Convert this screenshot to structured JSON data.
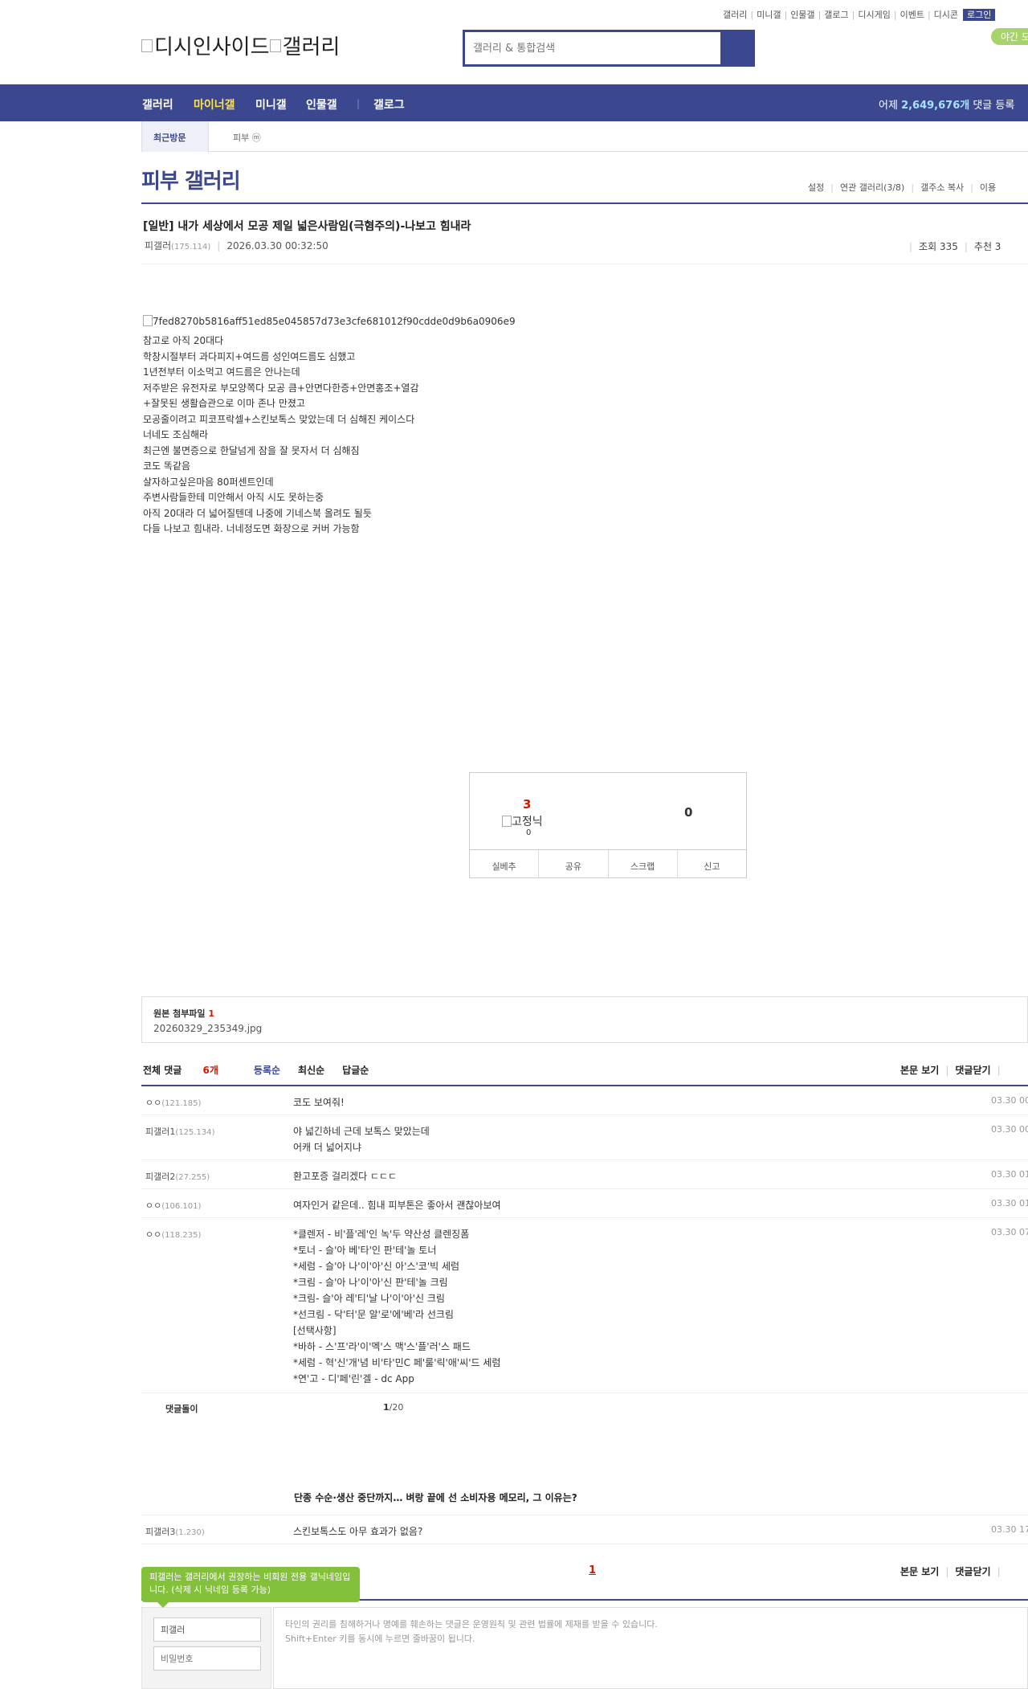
{
  "top_util": {
    "links": [
      "갤러리",
      "미니갤",
      "인물갤",
      "갤로그",
      "디시게임",
      "이벤트",
      "디시콘"
    ],
    "login": "로그인",
    "night_mode": "야간 모"
  },
  "logo": {
    "site": "디시인사이드",
    "section": "갤러리"
  },
  "search": {
    "placeholder": "갤러리 & 통합검색"
  },
  "nav": {
    "items": [
      "갤러리",
      "마이너갤",
      "미니갤",
      "인물갤",
      "갤로그"
    ],
    "comment_count_prefix": "어제 ",
    "comment_count_value": "2,649,676개",
    "comment_count_suffix": " 댓글 등록"
  },
  "recent": {
    "tab": "최근방문",
    "item": "피부 ⓜ"
  },
  "gallery": {
    "title": "피부 갤러리",
    "menu": [
      "설정",
      "연관 갤러리(3/8)",
      "갤주소 복사",
      "이용"
    ]
  },
  "post": {
    "title": "[일반] 내가 세상에서 모공 제일 넓은사람임(극혐주의)-나보고 힘내라",
    "writer": "피갤러",
    "writer_ip": "(175.114)",
    "date": "2026.03.30 00:32:50",
    "views": "조회 335",
    "recommends": "추천 3",
    "image_alt": "7fed8270b5816aff51ed85e045857d73e3cfe681012f90cdde0d9b6a0906e9",
    "body": [
      "참고로 아직 20대다",
      "학창시절부터 과다피지+여드름 성인여드름도 심했고",
      "1년전부터 이소먹고 여드름은 안나는데",
      "저주받은 유전자로 부모양쪽다 모공 큼+안면다한증+안면홍조+열감",
      "+잘못된 생활습관으로 이마 존나 만졌고",
      "모공줄이려고 피코프락셀+스킨보톡스 맞았는데 더 심해진 케이스다",
      "너네도 조심해라",
      "최근엔 불면증으로 한달넘게 잠을 잘 못자서 더 심해짐",
      "코도 똑같음",
      "살자하고싶은마음 80퍼센트인데",
      "주변사람들한테 미안해서 아직 시도 못하는중",
      "아직 20대라 더 넓어질텐데 나중에 기네스북 올려도 될듯",
      "다들 나보고 힘내라. 너네정도면 화장으로 커버 가능함"
    ]
  },
  "vote": {
    "up": "3",
    "fixnick_alt": "고정닉",
    "fixnick_count": "0",
    "down": "0",
    "actions": [
      "실베추",
      "공유",
      "스크랩",
      "신고"
    ]
  },
  "attachment": {
    "label": "원본 첨부파일",
    "count": "1",
    "file": "20260329_235349.jpg"
  },
  "comments_header": {
    "total_label": "전체 댓글",
    "total_count": "6개",
    "sorts": [
      "등록순",
      "최신순",
      "답글순"
    ],
    "view_body": "본문 보기",
    "close_comments": "댓글닫기"
  },
  "comments": [
    {
      "nick": "ㅇㅇ",
      "ip": "(121.185)",
      "text": [
        "코도 보여줘!"
      ],
      "date": "03.30 00"
    },
    {
      "nick": "피갤러1",
      "ip": "(125.134)",
      "text": [
        "야 넓긴하네 근데 보톡스 맞았는데",
        "어캐 더 넓어지냐"
      ],
      "date": "03.30 00"
    },
    {
      "nick": "피갤러2",
      "ip": "(27.255)",
      "text": [
        "환고포증 걸리겠다 ㄷㄷㄷ"
      ],
      "date": "03.30 01"
    },
    {
      "nick": "ㅇㅇ",
      "ip": "(106.101)",
      "text": [
        "여자인거 같은데.. 힘내 피부톤은 좋아서 괜찮아보여"
      ],
      "date": "03.30 01"
    },
    {
      "nick": "ㅇㅇ",
      "ip": "(118.235)",
      "text": [
        "*클렌저 - 비'플'레'인 녹'두 약산성 클렌징폼",
        "*토너 - 슬'아 베'타'인 판'테'놀 토너",
        "*세럼 - 슬'아 나'이'아'신 아'스'코'빅 세럼",
        "*크림 - 슬'아 나'이'아'신 판'테'놀 크림",
        "*크림- 슬'아 레'티'날 나'이'아'신 크림",
        "*선크림 - 닥'터'문 알'로'에'베'라 선크림",
        "[선택사항]",
        "*바하 - 스'프'라'이'멕'스 맥'스'플'러'스 패드",
        "*세럼 - 혁'신'개'념 비'타'민C 페'룰'릭'애'씨'드 세럼",
        "*연'고 - 디'페'린'겔 - dc App"
      ],
      "date": "03.30 07"
    }
  ],
  "reply_bot": {
    "label": "댓글돌이",
    "page_current": "1",
    "page_total": "/20"
  },
  "ad_headline": "단종 수순·생산 중단까지… 벼랑 끝에 선 소비자용 메모리, 그 이유는?",
  "last_comment": {
    "nick": "피갤러3",
    "ip": "(1.230)",
    "text": [
      "스킨보톡스도 아무 효과가 없음?"
    ],
    "date": "03.30 17"
  },
  "pagination": {
    "current": "1"
  },
  "write": {
    "tooltip": "피갤러는 갤러리에서 권장하는 비회원 전용 갤닉네임입니다. (삭제 시 닉네임 등록 가능)",
    "nick_value": "피갤러",
    "password_placeholder": "비밀번호",
    "notice_1": "타인의 권리를 침해하거나 명예를 훼손하는 댓글은 운영원칙 및 관련 법률에 제재를 받을 수 있습니다.",
    "notice_2": "Shift+Enter 키를 동시에 누르면 줄바꿈이 됩니다."
  }
}
